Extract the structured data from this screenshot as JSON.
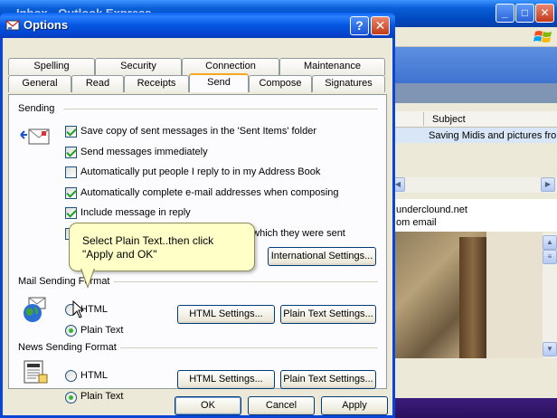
{
  "background_window": {
    "title": "Inbox - Outlook Express",
    "list_header": {
      "subject": "Subject"
    },
    "list_row": {
      "subject": "Saving Midis and pictures from"
    },
    "preview": {
      "from": "underclound.net",
      "line2": "om email"
    }
  },
  "dialog": {
    "title": "Options",
    "tabs_top": [
      "Spelling",
      "Security",
      "Connection",
      "Maintenance"
    ],
    "tabs_bottom": [
      "General",
      "Read",
      "Receipts",
      "Send",
      "Compose",
      "Signatures"
    ],
    "active_tab": "Send",
    "sending": {
      "label": "Sending",
      "options": [
        {
          "label": "Save copy of sent messages in the 'Sent Items' folder",
          "checked": true
        },
        {
          "label": "Send messages immediately",
          "checked": true
        },
        {
          "label": "Automatically put people I reply to in my Address Book",
          "checked": false
        },
        {
          "label": "Automatically complete e-mail addresses when composing",
          "checked": true
        },
        {
          "label": "Include message in reply",
          "checked": true
        },
        {
          "label": "Reply to messages using the format in which they were sent",
          "checked": false
        }
      ],
      "international_button": "International Settings..."
    },
    "mail_format": {
      "label": "Mail Sending Format",
      "html": "HTML",
      "plain": "Plain Text",
      "selected": "plain",
      "html_settings": "HTML Settings...",
      "plain_settings": "Plain Text Settings..."
    },
    "news_format": {
      "label": "News Sending Format",
      "html": "HTML",
      "plain": "Plain Text",
      "selected": "plain",
      "html_settings": "HTML Settings...",
      "plain_settings": "Plain Text Settings..."
    },
    "buttons": {
      "ok": "OK",
      "cancel": "Cancel",
      "apply": "Apply"
    }
  },
  "tooltip": {
    "line1": "Select Plain Text..then click",
    "line2": "\"Apply and OK\""
  },
  "colors": {
    "xp_blue": "#0a46d6",
    "tab_highlight": "#f7a71c",
    "tooltip_bg": "#ffffc8",
    "check_green": "#21a121"
  }
}
